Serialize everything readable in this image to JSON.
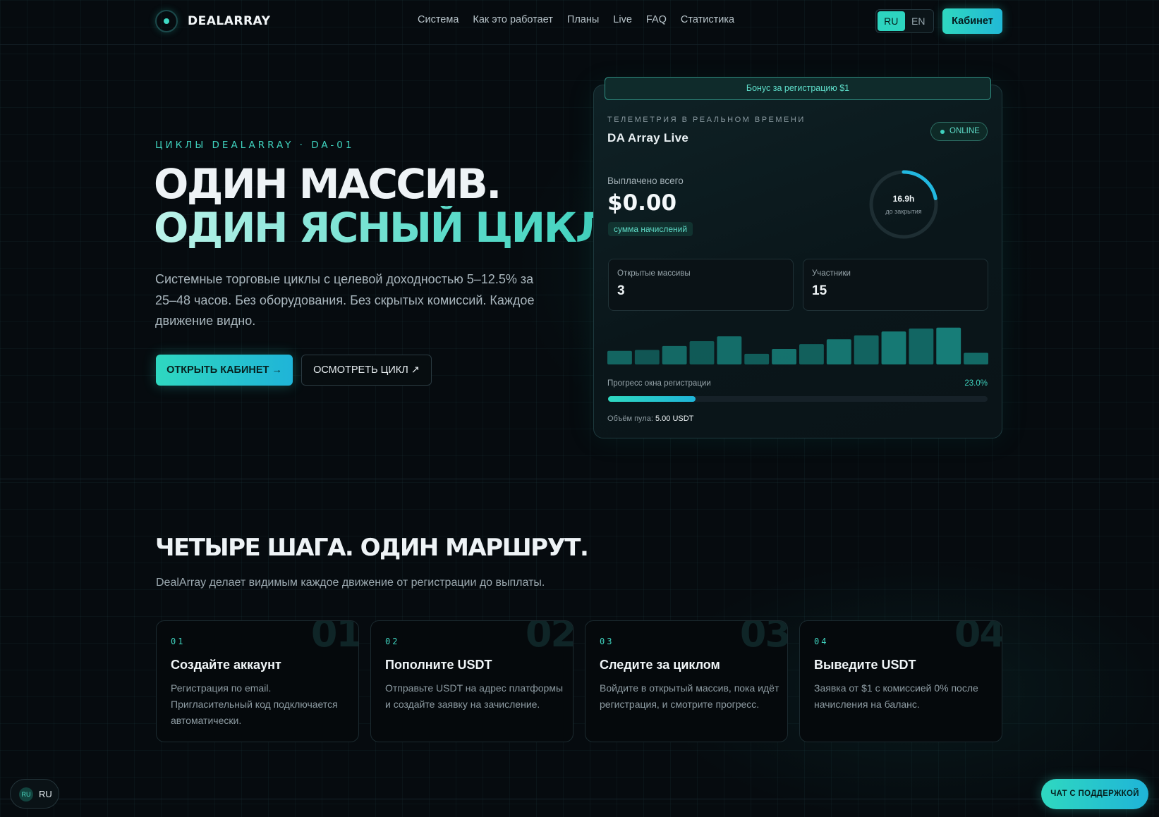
{
  "header": {
    "logo": "DEALARRAY",
    "nav": [
      "Система",
      "Как это работает",
      "Планы",
      "Live",
      "FAQ",
      "Статистика"
    ],
    "lang": [
      "RU",
      "EN"
    ],
    "lang_active": "RU",
    "cabinet": "Кабинет"
  },
  "hero": {
    "eyebrow": "ЦИКЛЫ DEALARRAY · DA-01",
    "title_line1": "ОДИН МАССИВ.",
    "title_line2": "ОДИН ЯСНЫЙ ЦИКЛ.",
    "lead": "Системные торговые циклы с целевой доходностью 5–12.5% за 25–48 часов. Без оборудования. Без скрытых комиссий. Каждое движение видно.",
    "cta_primary": "ОТКРЫТЬ КАБИНЕТ →",
    "cta_secondary": "ОСМОТРЕТЬ ЦИКЛ ↗"
  },
  "telemetry": {
    "bonus": "Бонус за регистрацию $1",
    "label": "ТЕЛЕМЕТРИЯ В РЕАЛЬНОМ ВРЕМЕНИ",
    "title": "DA Array Live",
    "status": "ONLINE",
    "paid_label": "Выплачено всего",
    "paid_value": "$0.00",
    "accrual_badge": "сумма начислений",
    "ring_value": "16.9h",
    "ring_sub": "до закрытия",
    "ring_fraction": 0.22,
    "open_arrays_label": "Открытые массивы",
    "open_arrays_value": "3",
    "participants_label": "Участники",
    "participants_value": "15",
    "activity_bars": [
      14,
      15,
      19,
      24,
      29,
      11,
      16,
      21,
      26,
      30,
      34,
      37,
      38,
      12
    ],
    "progress_label": "Прогресс окна регистрации",
    "progress_pct": "23.0%",
    "progress_value": 23.0,
    "pool_label": "Объём пула:",
    "pool_value": "5.00 USDT"
  },
  "steps": {
    "title": "ЧЕТЫРЕ ШАГА. ОДИН МАРШРУТ.",
    "subtitle": "DealArray делает видимым каждое движение от регистрации до выплаты.",
    "items": [
      {
        "num": "01",
        "ghost": "01",
        "title": "Создайте аккаунт",
        "desc": "Регистрация по email. Пригласительный код подключается автоматически."
      },
      {
        "num": "02",
        "ghost": "02",
        "title": "Пополните USDT",
        "desc": "Отправьте USDT на адрес платформы и создайте заявку на зачисление."
      },
      {
        "num": "03",
        "ghost": "03",
        "title": "Следите за циклом",
        "desc": "Войдите в открытый массив, пока идёт регистрация, и смотрите прогресс."
      },
      {
        "num": "04",
        "ghost": "04",
        "title": "Выведите USDT",
        "desc": "Заявка от $1 с комиссией 0% после начисления на баланс."
      }
    ]
  },
  "footer": {
    "lang_badge": "RU",
    "lang_text": "RU",
    "support": "ЧАТ С ПОДДЕРЖКОЙ"
  },
  "colors": {
    "accent": "#2dd4bf",
    "accent2": "#1fb4d8",
    "background": "#060b0f"
  }
}
